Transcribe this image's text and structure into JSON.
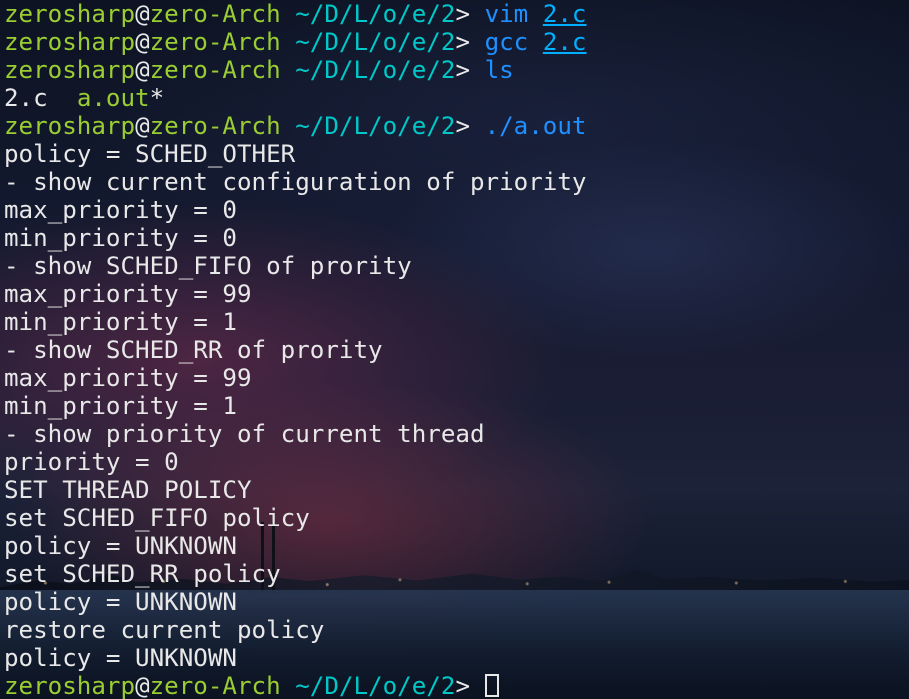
{
  "prompt": {
    "user": "zerosharp",
    "at": "@",
    "host": "zero-Arch",
    "path": "~/D/L/o/e/2",
    "symbol": "> "
  },
  "commands": [
    {
      "cmd": "vim",
      "arg": "2.c"
    },
    {
      "cmd": "gcc",
      "arg": "2.c"
    },
    {
      "cmd": "ls"
    },
    {
      "cmd": "./a.out"
    }
  ],
  "ls_output": {
    "file1": "2.c",
    "file2": "a.out",
    "file2_suffix": "*"
  },
  "output": [
    "policy = SCHED_OTHER",
    "- show current configuration of priority",
    "max_priority = 0",
    "min_priority = 0",
    "- show SCHED_FIFO of prority",
    "max_priority = 99",
    "min_priority = 1",
    "- show SCHED_RR of prority",
    "max_priority = 99",
    "min_priority = 1",
    "- show priority of current thread",
    "priority = 0",
    "SET THREAD POLICY",
    "set SCHED_FIFO policy",
    "policy = UNKNOWN",
    "set SCHED_RR policy",
    "policy = UNKNOWN",
    "restore current policy",
    "policy = UNKNOWN"
  ],
  "colors": {
    "user_host": "#9acd32",
    "path": "#00c8c8",
    "command": "#1e90ff",
    "argument": "#00b0ff",
    "text": "#e8e8e8"
  }
}
